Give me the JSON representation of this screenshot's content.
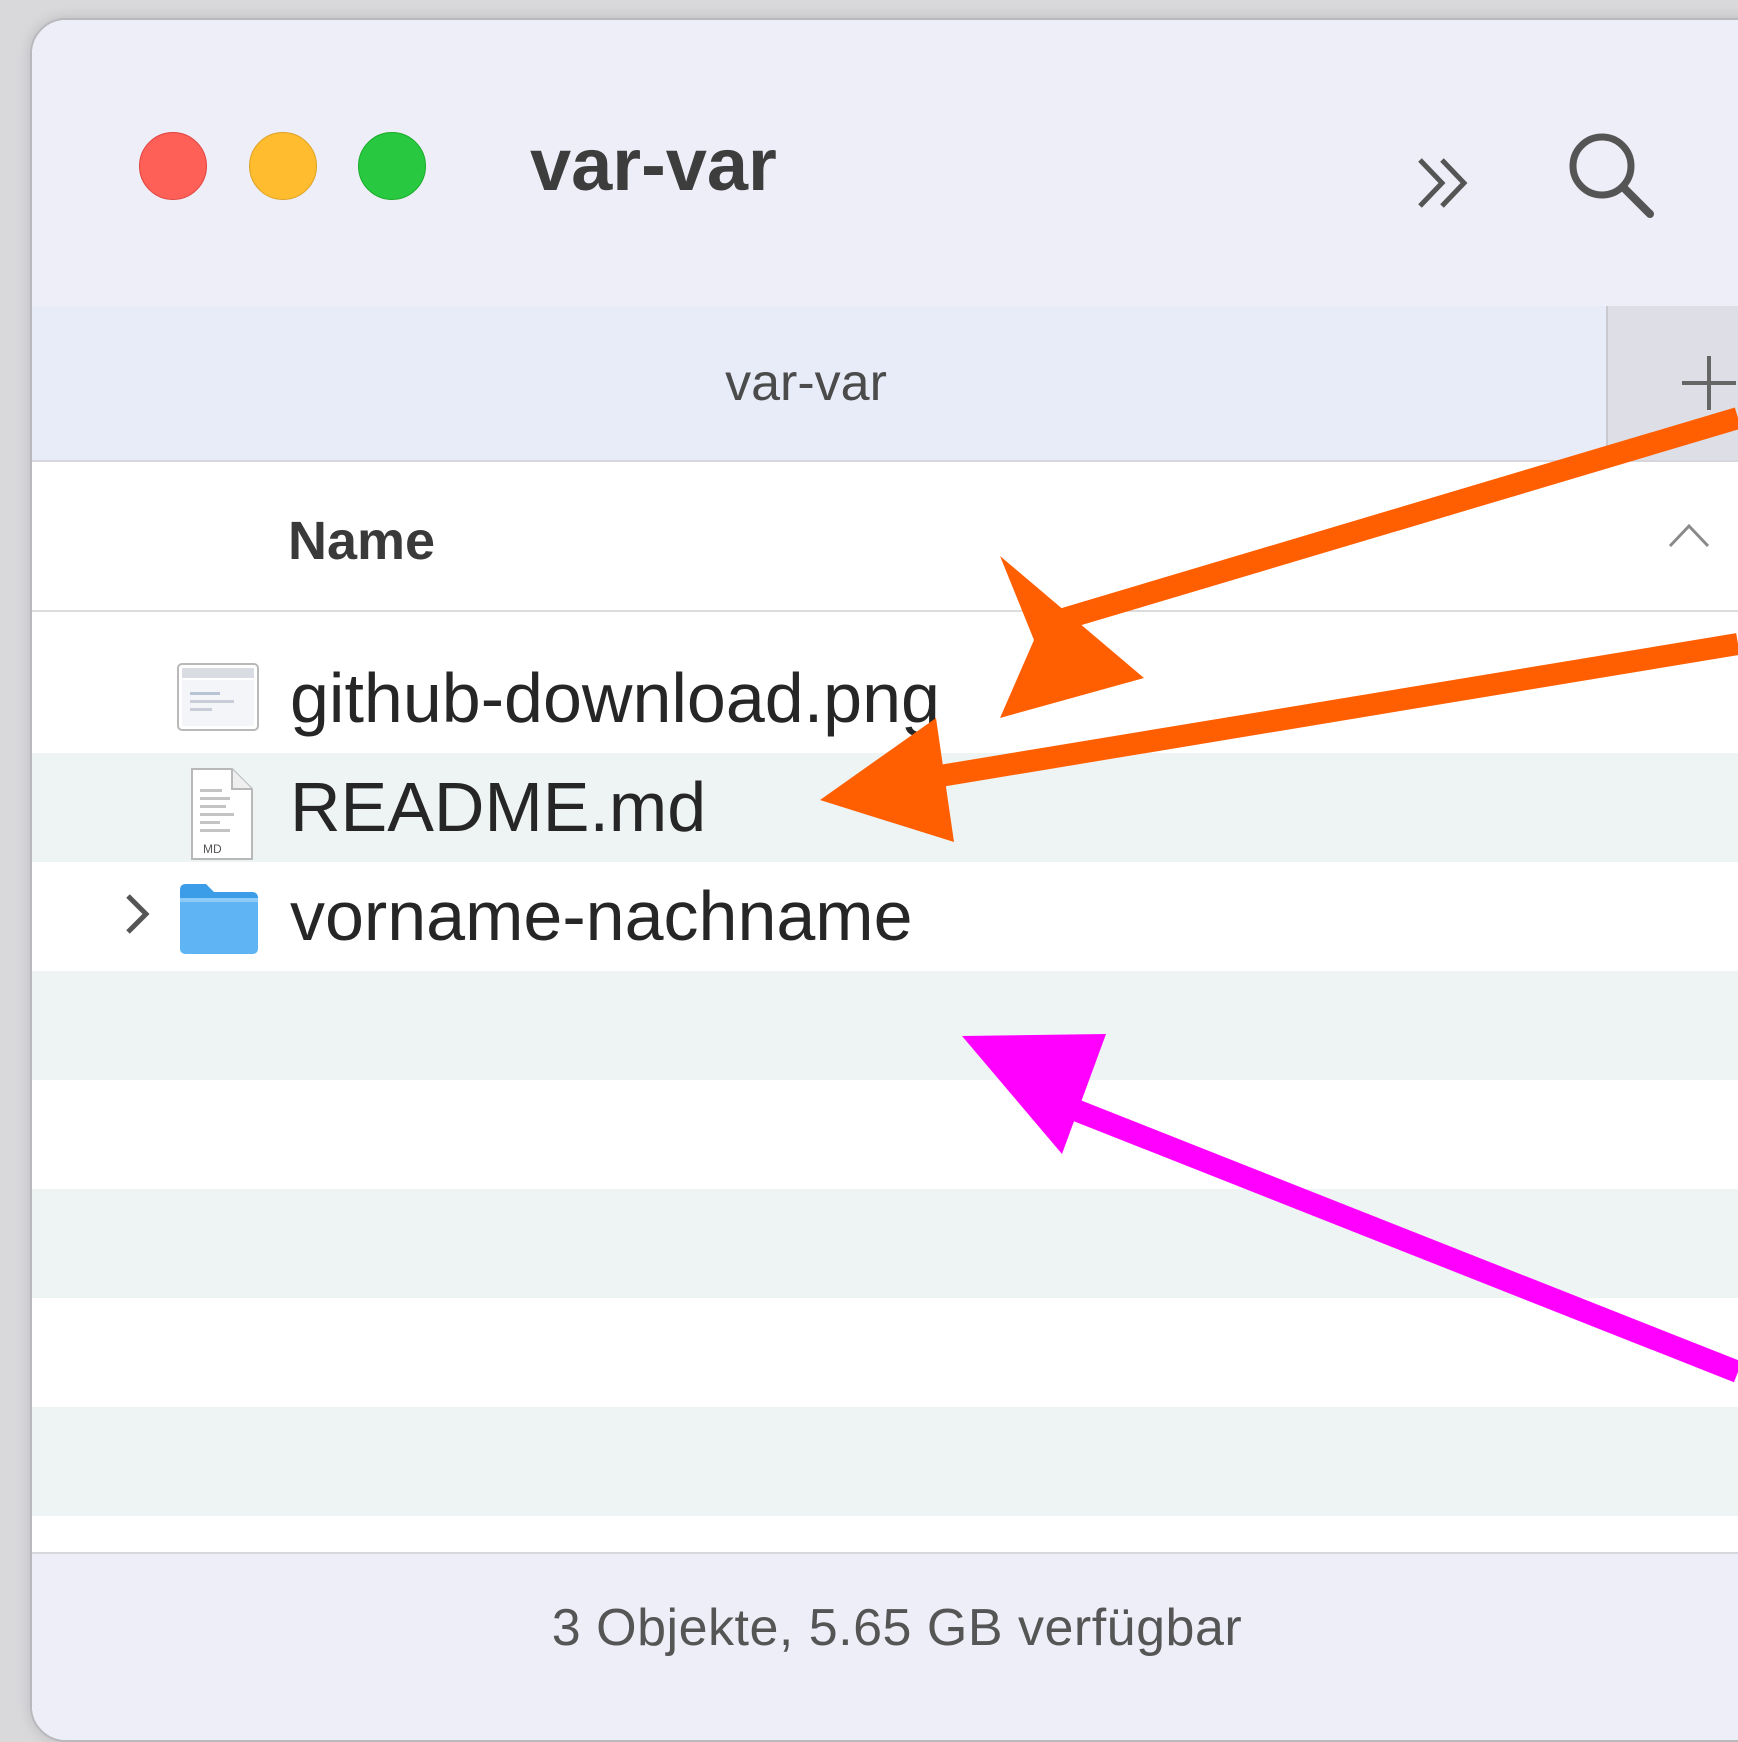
{
  "window": {
    "title": "var-var",
    "controls": [
      "close",
      "minimize",
      "maximize"
    ],
    "toolbar_icons": [
      "more-chevrons-icon",
      "search-icon"
    ]
  },
  "tabbar": {
    "active_tab": "var-var",
    "new_tab_icon": "plus-icon"
  },
  "column_header": {
    "name_label": "Name",
    "sort_indicator": "chevron-up-icon"
  },
  "files": [
    {
      "name": "github-download.png",
      "type": "png-image",
      "icon": "image-file-icon"
    },
    {
      "name": "README.md",
      "type": "markdown",
      "icon": "markdown-file-icon",
      "badge": "MD"
    },
    {
      "name": "vorname-nachname",
      "type": "folder",
      "icon": "folder-icon",
      "expandable": true
    }
  ],
  "status": {
    "text": "3 Objekte, 5.65 GB verfügbar"
  },
  "annotations": {
    "arrow_colors": {
      "orange": "#ff5f00",
      "magenta": "#ff00ff"
    }
  }
}
